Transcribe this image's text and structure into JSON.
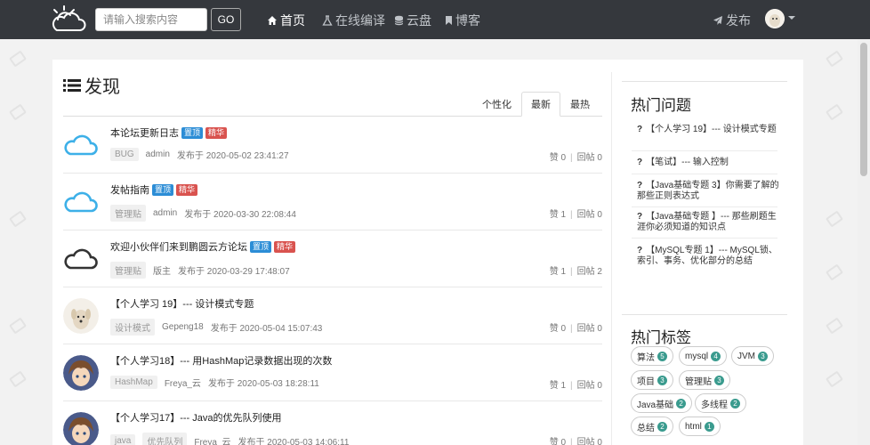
{
  "navbar": {
    "search_placeholder": "请输入搜索内容",
    "go_label": "GO",
    "links": [
      {
        "label": "首页",
        "icon": "home-icon"
      },
      {
        "label": "在线编译",
        "icon": "flask-icon"
      },
      {
        "label": "云盘",
        "icon": "database-icon"
      },
      {
        "label": "博客",
        "icon": "bookmark-icon"
      }
    ],
    "publish_label": "发布"
  },
  "main": {
    "title": "发现",
    "tabs": [
      "个性化",
      "最新",
      "最热"
    ],
    "active_tab": "最新",
    "posts": [
      {
        "title": "本论坛更新日志",
        "badges": [
          "置顶",
          "精华"
        ],
        "tag": "BUG",
        "author": "admin",
        "date": "发布于 2020-05-02 23:41:27",
        "likes": "赞 0",
        "replies": "回帖 0"
      },
      {
        "title": "发帖指南",
        "badges": [
          "置顶",
          "精华"
        ],
        "tag": "管理贴",
        "author": "admin",
        "date": "发布于 2020-03-30 22:08:44",
        "likes": "赞 1",
        "replies": "回帖 0"
      },
      {
        "title": "欢迎小伙伴们来到鹏圆云方论坛",
        "badges": [
          "置顶",
          "精华"
        ],
        "tag": "管理贴",
        "author": "版主",
        "date": "发布于 2020-03-29 17:48:07",
        "likes": "赞 1",
        "replies": "回帖 2"
      },
      {
        "title": "【个人学习 19】--- 设计模式专题",
        "badges": [],
        "tag": "设计模式",
        "author": "Gepeng18",
        "date": "发布于 2020-05-04 15:07:43",
        "likes": "赞 0",
        "replies": "回帖 0"
      },
      {
        "title": "【个人学习18】--- 用HashMap记录数据出现的次数",
        "badges": [],
        "tag": "HashMap",
        "author": "Freya_云",
        "date": "发布于 2020-05-03 18:28:11",
        "likes": "赞 1",
        "replies": "回帖 0"
      },
      {
        "title": "【个人学习17】--- Java的优先队列使用",
        "badges": [],
        "tag": "java",
        "tag2": "优先队列",
        "author": "Freya_云",
        "date": "发布于 2020-05-03 14:06:11",
        "likes": "赞 0",
        "replies": "回帖 0"
      }
    ]
  },
  "sidebar": {
    "hot_questions_title": "热门问题",
    "questions": [
      "【个人学习 19】--- 设计模式专题",
      "【笔试】--- 输入控制",
      "【Java基础专题 3】你需要了解的那些正则表达式",
      "【Java基础专题 】--- 那些刷题生涯你必须知道的知识点",
      "【MySQL专题 1】--- MySQL锁、索引、事务、优化部分的总结"
    ],
    "hot_tags_title": "热门标签",
    "tags": [
      {
        "name": "算法",
        "count": "5"
      },
      {
        "name": "mysql",
        "count": "4"
      },
      {
        "name": "JVM",
        "count": "3"
      },
      {
        "name": "项目",
        "count": "3"
      },
      {
        "name": "管理贴",
        "count": "3"
      },
      {
        "name": "Java基础",
        "count": "2"
      },
      {
        "name": "多线程",
        "count": "2"
      },
      {
        "name": "总结",
        "count": "2"
      },
      {
        "name": "html",
        "count": "1"
      }
    ]
  },
  "colors": {
    "navbar_bg": "#35383d",
    "badge_top": "#2c8dd6",
    "badge_best": "#d9534f",
    "count_badge": "#3a9b8e",
    "cloud_blue": "#3db0e8"
  }
}
